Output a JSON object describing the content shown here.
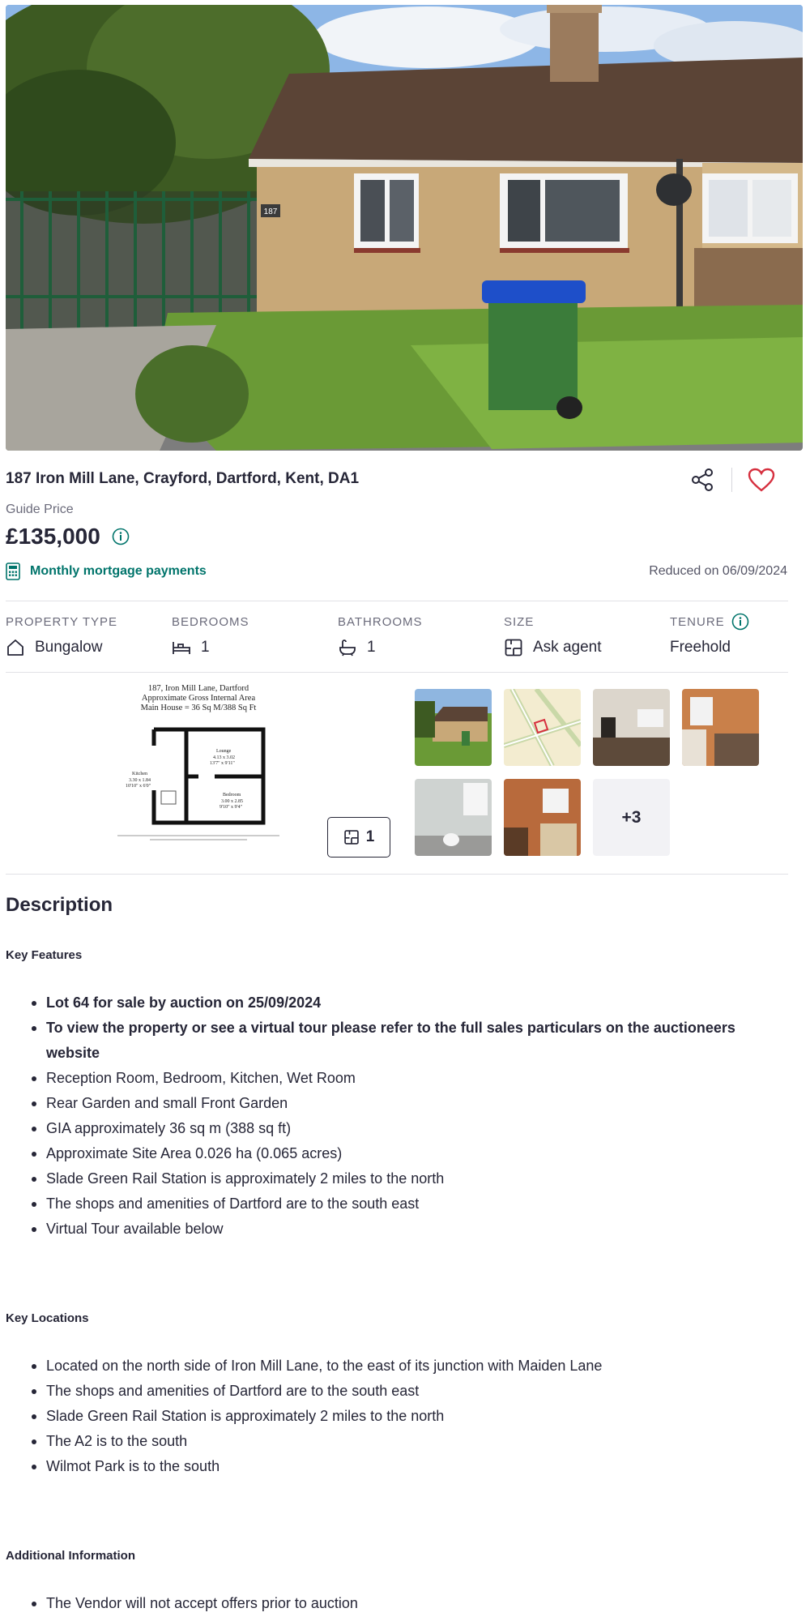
{
  "listing": {
    "address": "187 Iron Mill Lane, Crayford, Dartford, Kent, DA1",
    "guide_label": "Guide Price",
    "price": "£135,000",
    "mortgage_link": "Monthly mortgage payments",
    "reduced": "Reduced on 06/09/2024",
    "house_number_sign": "187"
  },
  "key_info": [
    {
      "label": "PROPERTY TYPE",
      "value": "Bungalow",
      "icon": "house-icon"
    },
    {
      "label": "BEDROOMS",
      "value": "1",
      "icon": "bed-icon"
    },
    {
      "label": "BATHROOMS",
      "value": "1",
      "icon": "bath-icon"
    },
    {
      "label": "SIZE",
      "value": "Ask agent",
      "icon": "floorplan-icon"
    },
    {
      "label": "TENURE",
      "value": "Freehold",
      "icon": "info-icon"
    }
  ],
  "media": {
    "floorplan_title": "187, Iron Mill Lane, Dartford",
    "floorplan_subtitle": "Approximate Gross Internal Area",
    "floorplan_area": "Main House = 36 Sq M/388 Sq Ft",
    "room_kitchen": "Kitchen",
    "room_kitchen_dims": "3.30 x 1.84",
    "room_kitchen_dims_ft": "10'10\" x 6'0\"",
    "room_lounge": "Lounge",
    "room_lounge_dims": "4.13 x 3.02",
    "room_lounge_dims_ft": "13'7\" x 9'11\"",
    "room_bedroom": "Bedroom",
    "room_bedroom_dims": "3.00 x 2.85",
    "room_bedroom_dims_ft": "9'10\" x 9'4\"",
    "floorplan_count": "1",
    "more_photos": "+3"
  },
  "description": {
    "title": "Description",
    "key_features_heading": "Key Features",
    "key_features": [
      "Lot 64 for sale by auction on 25/09/2024",
      "To view the property or see a virtual tour please refer to the full sales particulars on the auctioneers website",
      "Reception Room, Bedroom, Kitchen, Wet Room",
      "Rear Garden and small Front Garden",
      "GIA approximately 36 sq m (388 sq ft)",
      "Approximate Site Area 0.026 ha (0.065 acres)",
      "Slade Green Rail Station is approximately 2 miles to the north",
      "The shops and amenities of Dartford are to the south east",
      "Virtual Tour available below"
    ],
    "key_locations_heading": "Key Locations",
    "key_locations": [
      "Located on the north side of Iron Mill Lane, to the east of its junction with Maiden Lane",
      "The shops and amenities of Dartford are to the south east",
      "Slade Green Rail Station is approximately 2 miles to the north",
      "The A2 is to the south",
      "Wilmot Park is to the south"
    ],
    "additional_heading": "Additional Information",
    "additional": [
      "The Vendor will not accept offers prior to auction"
    ]
  },
  "colors": {
    "text": "#262637",
    "accent_teal": "#00746b",
    "favourite_red": "#d6303f",
    "muted": "#6b6b7b"
  }
}
